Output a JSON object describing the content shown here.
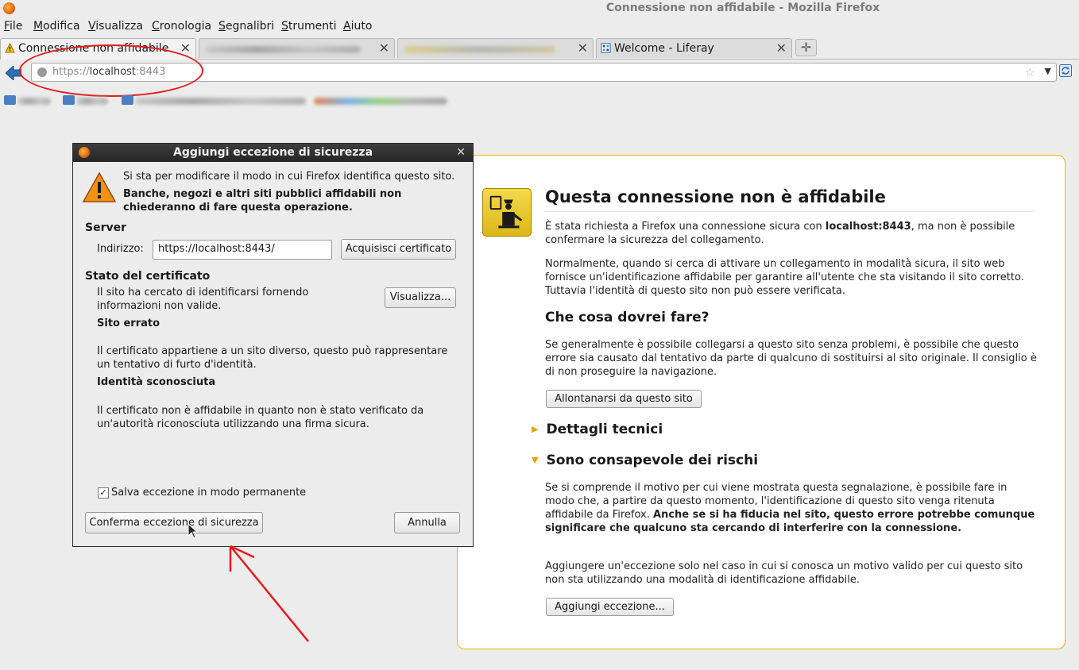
{
  "window": {
    "title": "Connessione non affidabile - Mozilla Firefox"
  },
  "menubar": {
    "items": [
      "File",
      "Modifica",
      "Visualizza",
      "Cronologia",
      "Segnalibri",
      "Strumenti",
      "Aiuto"
    ]
  },
  "tabs": [
    {
      "label": "Connessione non affidabile"
    },
    {
      "label": ""
    },
    {
      "label": ""
    },
    {
      "label": "Welcome - Liferay"
    }
  ],
  "urlbar": {
    "scheme": "https://",
    "host": "localhost",
    "port": ":8443"
  },
  "page": {
    "title": "Questa connessione non è affidabile",
    "p1_a": "È stata richiesta a Firefox una connessione sicura con ",
    "p1_host": "localhost:8443",
    "p1_b": ", ma non è possibile confermare la sicurezza del collegamento.",
    "p2": "Normalmente, quando si cerca di attivare un collegamento in modalità sicura, il sito web fornisce un'identificazione affidabile per garantire all'utente che sta visitando il sito corretto. Tuttavia l'identità di questo sito non può essere verificata.",
    "h_what": "Che cosa dovrei fare?",
    "p3": "Se generalmente è possibile collegarsi a questo sito senza problemi, è possibile che questo errore sia causato dal tentativo da parte di qualcuno di sostituirsi al sito originale. Il consiglio è di non proseguire la navigazione.",
    "btn_leave": "Allontanarsi da questo sito",
    "tech_details": "Dettagli tecnici",
    "risks": "Sono consapevole dei rischi",
    "p4_a": "Se si comprende il motivo per cui viene mostrata questa segnalazione, è possibile fare in modo che, a partire da questo momento, l'identificazione di questo sito venga ritenuta affidabile da Firefox. ",
    "p4_b": "Anche se si ha fiducia nel sito, questo errore potrebbe comunque significare che qualcuno sta cercando di interferire con la connessione.",
    "p5": "Aggiungere un'eccezione solo nel caso in cui si conosca un motivo valido per cui questo sito non sta utilizzando una modalità di identificazione affidabile.",
    "btn_add": "Aggiungi eccezione..."
  },
  "dialog": {
    "title": "Aggiungi eccezione di sicurezza",
    "intro": "Si sta per modificare il modo in cui Firefox identifica questo sito.",
    "warning": "Banche, negozi e altri siti pubblici affidabili non chiederanno di fare questa operazione.",
    "server_label": "Server",
    "address_label": "Indirizzo:",
    "address_value": "https://localhost:8443/",
    "get_cert": "Acquisisci certificato",
    "cert_status": "Stato del certificato",
    "cert_desc": "Il sito ha cercato di identificarsi fornendo informazioni non valide.",
    "view": "Visualizza...",
    "wrong_site": "Sito errato",
    "wrong_site_desc": "Il certificato appartiene a un sito diverso, questo può rappresentare un tentativo di furto d'identità.",
    "unknown_id": "Identità sconosciuta",
    "unknown_id_desc": "Il certificato non è affidabile in quanto non è stato verificato da un'autorità riconosciuta utilizzando una firma sicura.",
    "permanent": "Salva eccezione in modo permanente",
    "permanent_checked": true,
    "confirm": "Conferma eccezione di sicurezza",
    "cancel": "Annulla"
  },
  "colors": {
    "annotation_red": "#e31c1c",
    "error_border": "#f0b400",
    "shield_yellow": "#f4d94b"
  }
}
